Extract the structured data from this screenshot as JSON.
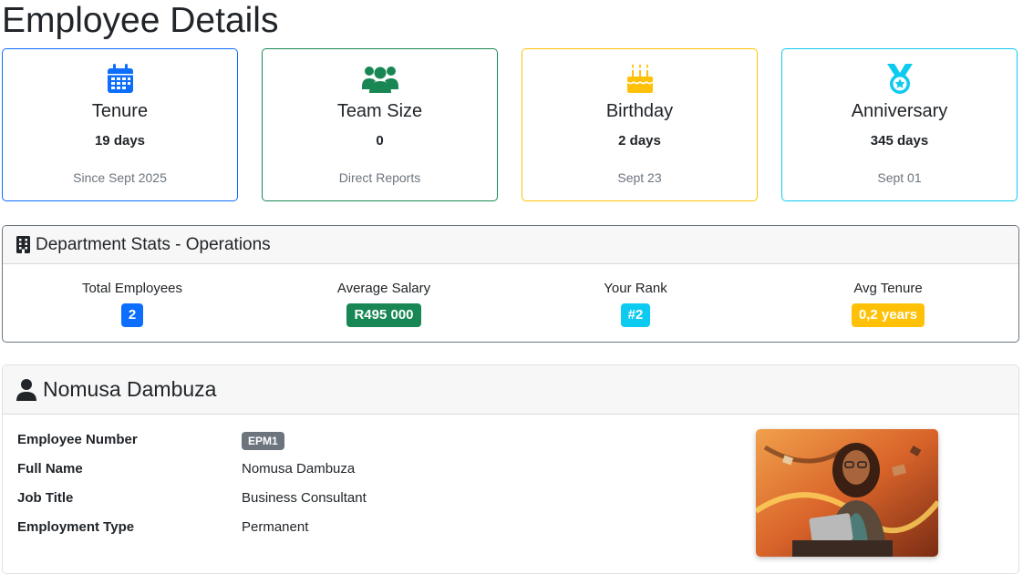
{
  "page": {
    "title": "Employee Details"
  },
  "stat_cards": [
    {
      "icon": "calendar-icon",
      "title": "Tenure",
      "value": "19 days",
      "subtitle": "Since Sept 2025",
      "color": "#0d6efd"
    },
    {
      "icon": "users-icon",
      "title": "Team Size",
      "value": "0",
      "subtitle": "Direct Reports",
      "color": "#198754"
    },
    {
      "icon": "birthday-cake-icon",
      "title": "Birthday",
      "value": "2 days",
      "subtitle": "Sept 23",
      "color": "#ffc107"
    },
    {
      "icon": "medal-icon",
      "title": "Anniversary",
      "value": "345 days",
      "subtitle": "Sept 01",
      "color": "#0dcaf0"
    }
  ],
  "department": {
    "icon": "building-icon",
    "title": "Department Stats - Operations",
    "stats": [
      {
        "label": "Total Employees",
        "value": "2",
        "color": "#0d6efd"
      },
      {
        "label": "Average Salary",
        "value": "R495 000",
        "color": "#198754"
      },
      {
        "label": "Your Rank",
        "value": "#2",
        "color": "#0dcaf0"
      },
      {
        "label": "Avg Tenure",
        "value": "0,2 years",
        "color": "#ffc107"
      }
    ]
  },
  "employee": {
    "icon": "user-icon",
    "name": "Nomusa Dambuza",
    "fields": {
      "employee_number": {
        "label": "Employee Number",
        "value": "EPM1"
      },
      "full_name": {
        "label": "Full Name",
        "value": "Nomusa Dambuza"
      },
      "job_title": {
        "label": "Job Title",
        "value": "Business Consultant"
      },
      "employment_type": {
        "label": "Employment Type",
        "value": "Permanent"
      }
    }
  }
}
